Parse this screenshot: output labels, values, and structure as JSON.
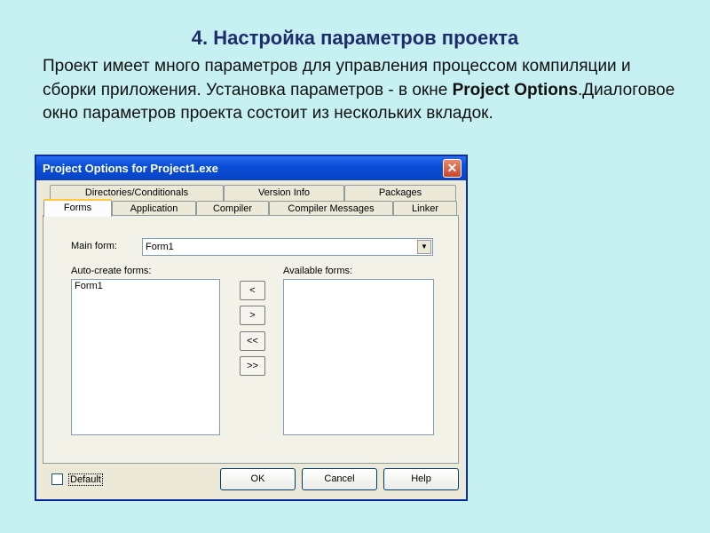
{
  "slide": {
    "title": "4. Настройка параметров проекта",
    "text_1": "Проект имеет много параметров для управления процессом компиляции и сборки приложения. Установка параметров - в окне ",
    "text_bold": "Project Options",
    "text_2": ".Диалоговое окно параметров проекта состоит из нескольких вкладок."
  },
  "dialog": {
    "title": "Project Options for Project1.exe",
    "close_glyph": "✕",
    "tabs_row1": [
      "Directories/Conditionals",
      "Version Info",
      "Packages"
    ],
    "tabs_row2": [
      "Forms",
      "Application",
      "Compiler",
      "Compiler Messages",
      "Linker"
    ],
    "main_form_label": "Main form:",
    "main_form_value": "Form1",
    "auto_create_label": "Auto-create forms:",
    "auto_create_items": [
      "Form1"
    ],
    "available_label": "Available forms:",
    "available_items": [],
    "move_buttons": [
      "<",
      ">",
      "<<",
      ">>"
    ],
    "default_label": "Default",
    "ok_label": "OK",
    "cancel_label": "Cancel",
    "help_label": "Help",
    "accent_color": "#0a4fd8"
  }
}
